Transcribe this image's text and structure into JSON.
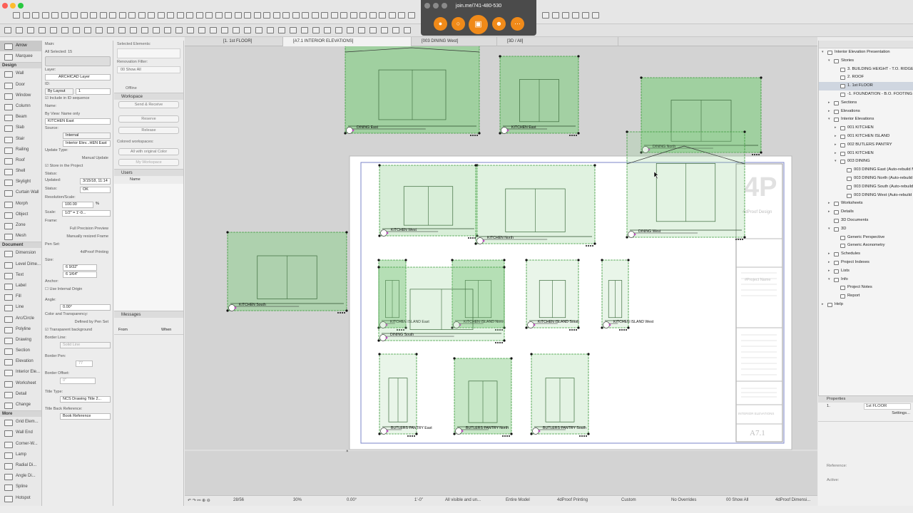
{
  "zoom_url": "join.me/741-480-530",
  "colors": {
    "green_fill": "#8fcf8f",
    "green_stroke": "#3a9a3a",
    "close": "#fc5f57",
    "min": "#fdbc2e",
    "max": "#28c840",
    "accent": "#f08a19"
  },
  "toolbox": {
    "pointer": [
      {
        "icon": "arrow-icon",
        "label": "Arrow",
        "selected": true
      },
      {
        "icon": "marquee-icon",
        "label": "Marquee"
      }
    ],
    "sections": [
      {
        "title": "Design",
        "tools": [
          "Wall",
          "Door",
          "Window",
          "Column",
          "Beam",
          "Slab",
          "Stair",
          "Railing",
          "Roof",
          "Shell",
          "Skylight",
          "Curtain Wall",
          "Morph",
          "Object",
          "Zone",
          "Mesh"
        ]
      },
      {
        "title": "Document",
        "tools": [
          "Dimension",
          "Level Dime...",
          "Text",
          "Label",
          "Fill",
          "Line",
          "Arc/Circle",
          "Polyline",
          "Drawing",
          "Section",
          "Elevation",
          "Interior Ele...",
          "Worksheet",
          "Detail",
          "Change"
        ]
      },
      {
        "title": "More",
        "tools": [
          "Grid Elem...",
          "Wall End",
          "Corner-W...",
          "Lamp",
          "Radial Di...",
          "Angle Di...",
          "Spline",
          "Hotspot"
        ]
      }
    ]
  },
  "info_box": {
    "main_label": "Main:",
    "all_selected": "All Selected: 15",
    "layer_label": "Layer:",
    "layer_value": "ARCHICAD Layer",
    "id_label": "ID:",
    "id_mode": "By Layout",
    "id_value": "1",
    "include_id": "Include in ID sequence",
    "name_label": "Name:",
    "name_mode": "By View: Name only",
    "name_value": "KITCHEN East",
    "source_label": "Source:",
    "source_value": "Internal",
    "source_view": "Interior Elev...HEN East",
    "update_type_label": "Update Type:",
    "update_type": "Manual Update",
    "store": "Store in the Project",
    "status_label": "Status:",
    "updated_label": "Updated:",
    "updated_value": "3/15/18, 11:14",
    "status_text": "Status:",
    "status_value": "OK",
    "resolution_label": "Resolution/Scale:",
    "resolution_value": "100.00",
    "resolution_unit": "%",
    "scale_label": "Scale:",
    "scale_value": "1/2\" = 1'-0...",
    "frame_label": "Frame:",
    "frame1": "Full Precision Preview",
    "frame2": "Manually resized Frame",
    "penset_label": "Pen Set:",
    "penset_value": "4dProof Printing",
    "size_label": "Size:",
    "size_w": "6 9/32\"",
    "size_h": "6 1/64\"",
    "anchor_label": "Anchor:",
    "use_origin": "Use Internal Origin",
    "angle_label": "Angle:",
    "angle_value": "0.00°",
    "color_label": "Color and Transparency:",
    "color_value": "Defined by Pen Set",
    "transparent": "Transparent background",
    "border_line_label": "Border Line:",
    "border_line": "Solid Line",
    "border_pen_label": "Border Pen:",
    "border_pen": "77",
    "border_offset_label": "Border Offset:",
    "border_offset": "0\"",
    "title_type_label": "Title Type:",
    "title_type": "NCS Drawing Title 2...",
    "title_back_label": "Title Back Reference:",
    "title_back": "Book Reference"
  },
  "organizer": {
    "selected_elements": "Selected Elements:",
    "renovation": "Renovation Filter:",
    "renovation_value": "00 Show All",
    "offline": "Offline",
    "workspace_hdr": "Workspace",
    "send_receive": "Send & Receive",
    "reserve": "Reserve",
    "release": "Release",
    "colored": "Colored workspaces:",
    "color_value": "All with original Color",
    "my_workspace": "My Workspace",
    "users_hdr": "Users",
    "name_col": "Name",
    "messages_hdr": "Messages",
    "from_col": "From",
    "when_col": "When"
  },
  "tabs": [
    "[1. 1st FLOOR]",
    "[A7.1 INTERIOR ELEVATIONS]",
    "[003 DINING West]",
    "[3D / All]"
  ],
  "drawings": {
    "dining_east": "DINING East",
    "kitchen_east": "KITCHEN East",
    "dining_north": "DINING North",
    "kitchen_west": "KITCHEN West",
    "kitchen_north": "KITCHEN North",
    "dining_west": "DINING West",
    "kitchen_south": "KITCHEN South",
    "island_east": "KITCHEN ISLAND East",
    "island_north": "KITCHEN ISLAND North",
    "island_south": "KITCHEN ISLAND South",
    "island_west": "KITCHEN ISLAND West",
    "dining_south": "DINING South",
    "butlers_east": "BUTLERS PANTRY East",
    "butlers_north": "BUTLERS PANTRY North",
    "butlers_south": "BUTLERS PANTRY South"
  },
  "title_block": {
    "logo": "4P",
    "company": "4dProof Design",
    "project": "#Project Name",
    "sheet_title": "INTERIOR ELEVATIONS",
    "sheet_no": "A7.1"
  },
  "status_bar": {
    "page": "28/56",
    "zoom": "30%",
    "angle": "0.00°",
    "scale": "1'-0\"",
    "layers": "All visible and un...",
    "model": "Entire Model",
    "penset": "4dProof Printing",
    "custom": "Custom",
    "overrides": "No Overrides",
    "renov": "00 Show All",
    "dims": "4dProof Dimensi..."
  },
  "navigator": {
    "items": [
      {
        "label": "Interior Elevation Presentation",
        "d": 0,
        "tw": "▾",
        "ic": "plan"
      },
      {
        "label": "Stories",
        "d": 1,
        "tw": "▾",
        "ic": "folder"
      },
      {
        "label": "3. BUILDING HEIGHT - T.O. RIDGE",
        "d": 2,
        "ic": "story"
      },
      {
        "label": "2. ROOF",
        "d": 2,
        "ic": "story"
      },
      {
        "label": "1. 1st FLOOR",
        "d": 2,
        "ic": "story",
        "sel": true
      },
      {
        "label": "-1. FOUNDATION - B.O. FOOTING",
        "d": 2,
        "ic": "story"
      },
      {
        "label": "Sections",
        "d": 1,
        "tw": "▸",
        "ic": "folder"
      },
      {
        "label": "Elevations",
        "d": 1,
        "tw": "▸",
        "ic": "folder"
      },
      {
        "label": "Interior Elevations",
        "d": 1,
        "tw": "▾",
        "ic": "folder"
      },
      {
        "label": "001 KITCHEN",
        "d": 2,
        "tw": "▸",
        "ic": "ie"
      },
      {
        "label": "001 KITCHEN ISLAND",
        "d": 2,
        "tw": "▸",
        "ic": "ie"
      },
      {
        "label": "002 BUTLERS PANTRY",
        "d": 2,
        "tw": "▸",
        "ic": "ie"
      },
      {
        "label": "001 KITCHEN",
        "d": 2,
        "tw": "▸",
        "ic": "ie"
      },
      {
        "label": "003 DINING",
        "d": 2,
        "tw": "▾",
        "ic": "ie"
      },
      {
        "label": "003 DINING East (Auto-rebuild Model)",
        "d": 3,
        "ic": "view"
      },
      {
        "label": "003 DINING North (Auto-rebuild Model)",
        "d": 3,
        "ic": "view"
      },
      {
        "label": "003 DINING South (Auto-rebuild Model)",
        "d": 3,
        "ic": "view"
      },
      {
        "label": "003 DINING West (Auto-rebuild Model)",
        "d": 3,
        "ic": "view"
      },
      {
        "label": "Worksheets",
        "d": 1,
        "tw": "▸",
        "ic": "folder"
      },
      {
        "label": "Details",
        "d": 1,
        "tw": "▸",
        "ic": "folder"
      },
      {
        "label": "3D Documents",
        "d": 1,
        "ic": "folder"
      },
      {
        "label": "3D",
        "d": 1,
        "tw": "▾",
        "ic": "folder"
      },
      {
        "label": "Generic Perspective",
        "d": 2,
        "ic": "view"
      },
      {
        "label": "Generic Axonometry",
        "d": 2,
        "ic": "view"
      },
      {
        "label": "Schedules",
        "d": 1,
        "tw": "▸",
        "ic": "folder"
      },
      {
        "label": "Project Indexes",
        "d": 1,
        "tw": "▸",
        "ic": "folder"
      },
      {
        "label": "Lists",
        "d": 1,
        "tw": "▸",
        "ic": "folder"
      },
      {
        "label": "Info",
        "d": 1,
        "tw": "▾",
        "ic": "folder"
      },
      {
        "label": "Project Notes",
        "d": 2,
        "ic": "doc"
      },
      {
        "label": "Report",
        "d": 2,
        "ic": "doc"
      },
      {
        "label": "Help",
        "d": 0,
        "tw": "▸",
        "ic": "folder"
      }
    ]
  },
  "properties": {
    "header": "Properties",
    "id": "1.",
    "story": "1st FLOOR",
    "settings": "Settings...",
    "reference": "Reference:",
    "active": "Active:"
  }
}
